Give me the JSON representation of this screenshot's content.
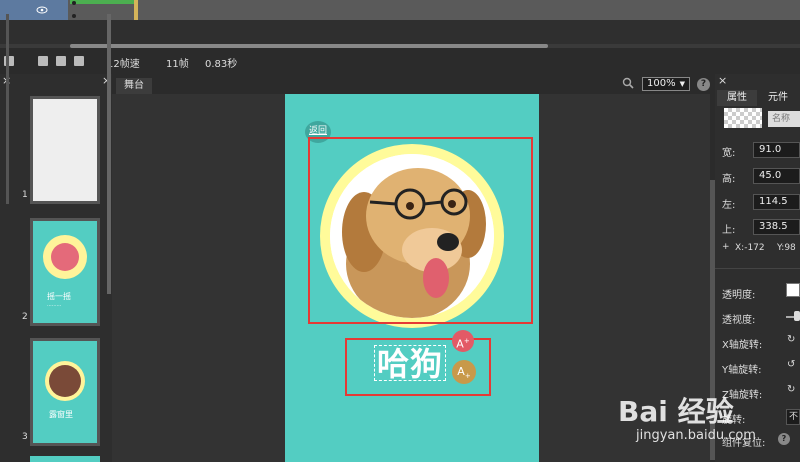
{
  "toolbar": {
    "fps": "12帧速",
    "frames": "11帧",
    "duration": "0.83秒"
  },
  "left_panel": {
    "pages": [
      {
        "num": "1"
      },
      {
        "num": "2",
        "title": "摇一摇",
        "sub": "·········"
      },
      {
        "num": "3",
        "title": "露窗里",
        "sub": ""
      }
    ]
  },
  "stage": {
    "tab_label": "舞台",
    "zoom": "100%",
    "help": "?",
    "back_button": "返回",
    "title_text": "哈狗",
    "btn_red": "A",
    "btn_gold": "A"
  },
  "right_panel": {
    "tab_props": "属性",
    "tab_elements": "元件",
    "name_placeholder": "名称",
    "width_label": "宽:",
    "width_value": "91.0",
    "height_label": "高:",
    "height_value": "45.0",
    "left_label": "左:",
    "left_value": "114.5",
    "top_label": "上:",
    "top_value": "338.5",
    "coord_plus": "+",
    "x_coord": "X:-172",
    "y_coord": "Y:98",
    "opacity_label": "透明度:",
    "perspective_label": "透视度:",
    "x_rotate_label": "X轴旋转:",
    "y_rotate_label": "Y轴旋转:",
    "z_rotate_label": "Z轴旋转:",
    "rotate_label": "旋转:",
    "rotate_value": "不",
    "reset_label": "组件复位:"
  },
  "watermark": {
    "text": "Bai 经验",
    "url": "jingyan.baidu.com"
  },
  "colors": {
    "phone_bg": "#53cdc2",
    "ring": "#fffb9a",
    "highlight": "#e53935",
    "btn_red": "#e35a66",
    "btn_gold": "#c8994a"
  }
}
